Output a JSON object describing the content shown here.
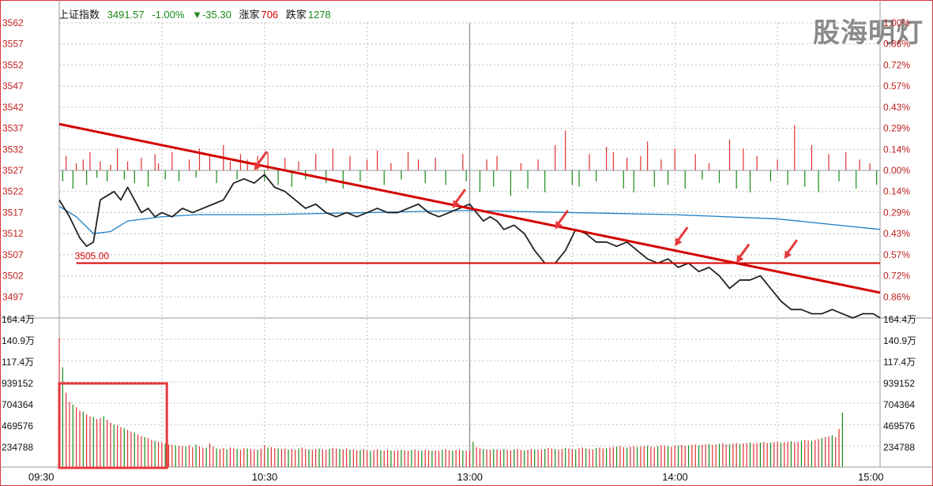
{
  "header": {
    "index_name": "上证指数",
    "price": "3491.57",
    "change_pct": "-1.00%",
    "change_pts": "▼-35.30",
    "up_label": "涨家",
    "up_count": "706",
    "down_label": "跌家",
    "down_count": "1278"
  },
  "watermark": "股海明灯",
  "colors": {
    "price_line": "#222222",
    "avg_line": "#1e7fc4",
    "trend_line": "#d40000",
    "up": "#e03030",
    "down": "#1a8a1a",
    "axis_left": "#c02020",
    "axis_right": "#c02020",
    "grid": "#bdbdbd"
  },
  "chart_data": {
    "type": "line",
    "title": "",
    "x_ticks": [
      "09:30",
      "10:30",
      "13:00",
      "14:00",
      "15:00"
    ],
    "price_axis": {
      "min": 3492,
      "max": 3562,
      "ticks": [
        "3562",
        "3557",
        "3552",
        "3547",
        "3542",
        "3537",
        "3532",
        "3527",
        "3522",
        "3517",
        "3512",
        "3507",
        "3502",
        "3497"
      ],
      "pct_ticks": [
        "1.00%",
        "0.86%",
        "0.72%",
        "0.57%",
        "0.43%",
        "0.29%",
        "0.14%",
        "0.00%",
        "0.14%",
        "0.29%",
        "0.43%",
        "0.57%",
        "0.72%",
        "0.86%"
      ],
      "prev_close": 3527
    },
    "volume_axis": {
      "min": 0,
      "max": 1644000,
      "ticks": [
        "164.4万",
        "140.9万",
        "117.4万",
        "939152",
        "704364",
        "469576",
        "234788"
      ]
    },
    "price_series": {
      "name": "",
      "minutes": [
        0,
        3,
        6,
        8,
        10,
        12,
        14,
        16,
        18,
        20,
        22,
        24,
        26,
        28,
        30,
        33,
        36,
        39,
        42,
        45,
        48,
        51,
        54,
        57,
        60,
        63,
        66,
        69,
        72,
        75,
        78,
        81,
        84,
        87,
        90,
        93,
        96,
        99,
        102,
        105,
        108,
        111,
        114,
        117,
        120,
        122,
        124,
        126,
        128,
        130,
        133,
        136,
        139,
        142,
        145,
        148,
        151,
        154,
        157,
        160,
        163,
        166,
        169,
        172,
        175,
        178,
        181,
        184,
        187,
        190,
        193,
        196,
        199,
        202,
        205,
        208,
        211,
        214,
        217,
        220,
        223,
        226,
        229,
        232,
        235,
        238,
        240
      ],
      "values": [
        3520,
        3516,
        3511,
        3509,
        3510,
        3520,
        3521,
        3522,
        3520,
        3523,
        3520,
        3517,
        3518,
        3516,
        3517,
        3516,
        3518,
        3517,
        3518,
        3519,
        3520,
        3524,
        3525,
        3524,
        3526,
        3523,
        3522,
        3520,
        3518,
        3519,
        3517,
        3516,
        3517,
        3516,
        3517,
        3518,
        3517,
        3517,
        3518,
        3519,
        3517,
        3516,
        3517,
        3518,
        3519,
        3517,
        3515,
        3516,
        3515,
        3513,
        3514,
        3512,
        3508,
        3505,
        3505,
        3508,
        3513,
        3512,
        3510,
        3510,
        3509,
        3510,
        3508,
        3506,
        3505,
        3506,
        3504,
        3505,
        3503,
        3504,
        3502,
        3499,
        3501,
        3501,
        3502,
        3499,
        3496,
        3494,
        3494,
        3493,
        3493,
        3494,
        3493,
        3492,
        3493,
        3493,
        3492
      ]
    },
    "avg_series": {
      "name": "",
      "minutes": [
        0,
        5,
        10,
        15,
        20,
        30,
        40,
        60,
        90,
        120,
        150,
        180,
        210,
        240
      ],
      "values": [
        3518.5,
        3516,
        3512,
        3512.5,
        3515,
        3516,
        3516.5,
        3516.5,
        3517,
        3517.5,
        3517,
        3516.5,
        3515.5,
        3513
      ]
    },
    "trend_line": {
      "from": {
        "minute": 0,
        "value": 3538
      },
      "to": {
        "minute": 240,
        "value": 3498
      }
    },
    "support_line": {
      "value": 3505,
      "label": "3505.00",
      "from_minute": 5,
      "to_minute": 240
    },
    "arrow_markers": [
      {
        "minute": 57,
        "value": 3527
      },
      {
        "minute": 115,
        "value": 3518
      },
      {
        "minute": 145,
        "value": 3513
      },
      {
        "minute": 180,
        "value": 3509
      },
      {
        "minute": 198,
        "value": 3505
      },
      {
        "minute": 212,
        "value": 3506
      }
    ],
    "breadth_bars": {
      "note_up_positive_down_negative": true,
      "up_minutes": [
        2,
        5,
        7,
        9,
        12,
        15,
        17,
        20,
        24,
        28,
        29,
        33,
        38,
        41,
        44,
        48,
        50,
        53,
        55,
        58,
        61,
        66,
        70,
        75,
        80,
        85,
        90,
        93,
        97,
        102,
        105,
        110,
        118,
        125,
        128,
        135,
        140,
        145,
        148,
        155,
        160,
        162,
        166,
        170,
        172,
        176,
        180,
        186,
        190,
        196,
        200,
        204,
        210,
        215,
        220,
        225,
        230,
        234,
        237
      ],
      "up_values": [
        8,
        4,
        6,
        10,
        5,
        3,
        12,
        5,
        7,
        9,
        4,
        10,
        6,
        12,
        8,
        14,
        5,
        9,
        6,
        8,
        10,
        7,
        5,
        9,
        12,
        8,
        6,
        11,
        4,
        10,
        6,
        7,
        9,
        6,
        8,
        4,
        6,
        14,
        22,
        9,
        13,
        10,
        7,
        8,
        16,
        6,
        12,
        9,
        4,
        17,
        12,
        8,
        6,
        25,
        14,
        9,
        10,
        6,
        4
      ],
      "down_minutes": [
        1,
        4,
        8,
        11,
        14,
        19,
        22,
        26,
        31,
        35,
        40,
        46,
        52,
        60,
        64,
        68,
        72,
        78,
        83,
        88,
        95,
        100,
        107,
        113,
        119,
        123,
        127,
        132,
        137,
        142,
        150,
        152,
        157,
        165,
        168,
        174,
        178,
        183,
        188,
        193,
        198,
        202,
        208,
        213,
        218,
        222,
        228,
        233,
        239
      ],
      "down_values": [
        6,
        10,
        8,
        4,
        6,
        5,
        7,
        9,
        5,
        6,
        4,
        7,
        5,
        6,
        8,
        9,
        5,
        7,
        10,
        6,
        8,
        5,
        7,
        8,
        6,
        12,
        9,
        14,
        10,
        12,
        8,
        9,
        6,
        10,
        12,
        9,
        8,
        10,
        5,
        7,
        10,
        12,
        6,
        8,
        9,
        12,
        6,
        10,
        8
      ]
    },
    "volume_series": {
      "name": "",
      "minutes_start": 0,
      "values": [
        1420000,
        1100000,
        820000,
        720000,
        690000,
        660000,
        620000,
        610000,
        580000,
        560000,
        550000,
        530000,
        540000,
        560000,
        520000,
        490000,
        470000,
        460000,
        440000,
        430000,
        410000,
        390000,
        380000,
        360000,
        340000,
        330000,
        320000,
        300000,
        290000,
        280000,
        270000,
        260000,
        250000,
        245000,
        240000,
        235000,
        230000,
        225000,
        240000,
        220000,
        250000,
        230000,
        215000,
        210000,
        260000,
        225000,
        205000,
        200000,
        210000,
        195000,
        215000,
        205000,
        200000,
        190000,
        210000,
        205000,
        200000,
        195000,
        190000,
        205000,
        240000,
        215000,
        220000,
        210000,
        205000,
        200000,
        205000,
        195000,
        200000,
        190000,
        205000,
        215000,
        200000,
        195000,
        190000,
        200000,
        205000,
        195000,
        190000,
        200000,
        210000,
        205000,
        200000,
        195000,
        205000,
        190000,
        195000,
        185000,
        190000,
        200000,
        185000,
        180000,
        190000,
        195000,
        185000,
        180000,
        190000,
        185000,
        180000,
        185000,
        190000,
        185000,
        180000,
        190000,
        195000,
        185000,
        180000,
        190000,
        185000,
        180000,
        185000,
        180000,
        190000,
        200000,
        185000,
        180000,
        190000,
        195000,
        185000,
        180000,
        180000,
        280000,
        220000,
        205000,
        200000,
        195000,
        190000,
        200000,
        195000,
        190000,
        200000,
        190000,
        185000,
        195000,
        200000,
        190000,
        185000,
        190000,
        200000,
        195000,
        190000,
        195000,
        200000,
        210000,
        205000,
        200000,
        195000,
        200000,
        210000,
        205000,
        200000,
        195000,
        210000,
        215000,
        205000,
        200000,
        195000,
        210000,
        215000,
        205000,
        210000,
        215000,
        220000,
        225000,
        230000,
        220000,
        215000,
        225000,
        230000,
        220000,
        225000,
        230000,
        235000,
        225000,
        220000,
        230000,
        240000,
        235000,
        230000,
        225000,
        235000,
        240000,
        245000,
        235000,
        240000,
        245000,
        250000,
        240000,
        245000,
        250000,
        255000,
        245000,
        250000,
        255000,
        260000,
        250000,
        255000,
        260000,
        265000,
        255000,
        260000,
        265000,
        270000,
        260000,
        265000,
        270000,
        275000,
        265000,
        270000,
        275000,
        280000,
        270000,
        275000,
        280000,
        285000,
        275000,
        280000,
        290000,
        300000,
        295000,
        290000,
        300000,
        310000,
        320000,
        330000,
        340000,
        350000,
        330000,
        420000,
        600000
      ]
    },
    "volume_highlight": {
      "from_minute": 0,
      "to_minute": 31,
      "label": ""
    }
  }
}
